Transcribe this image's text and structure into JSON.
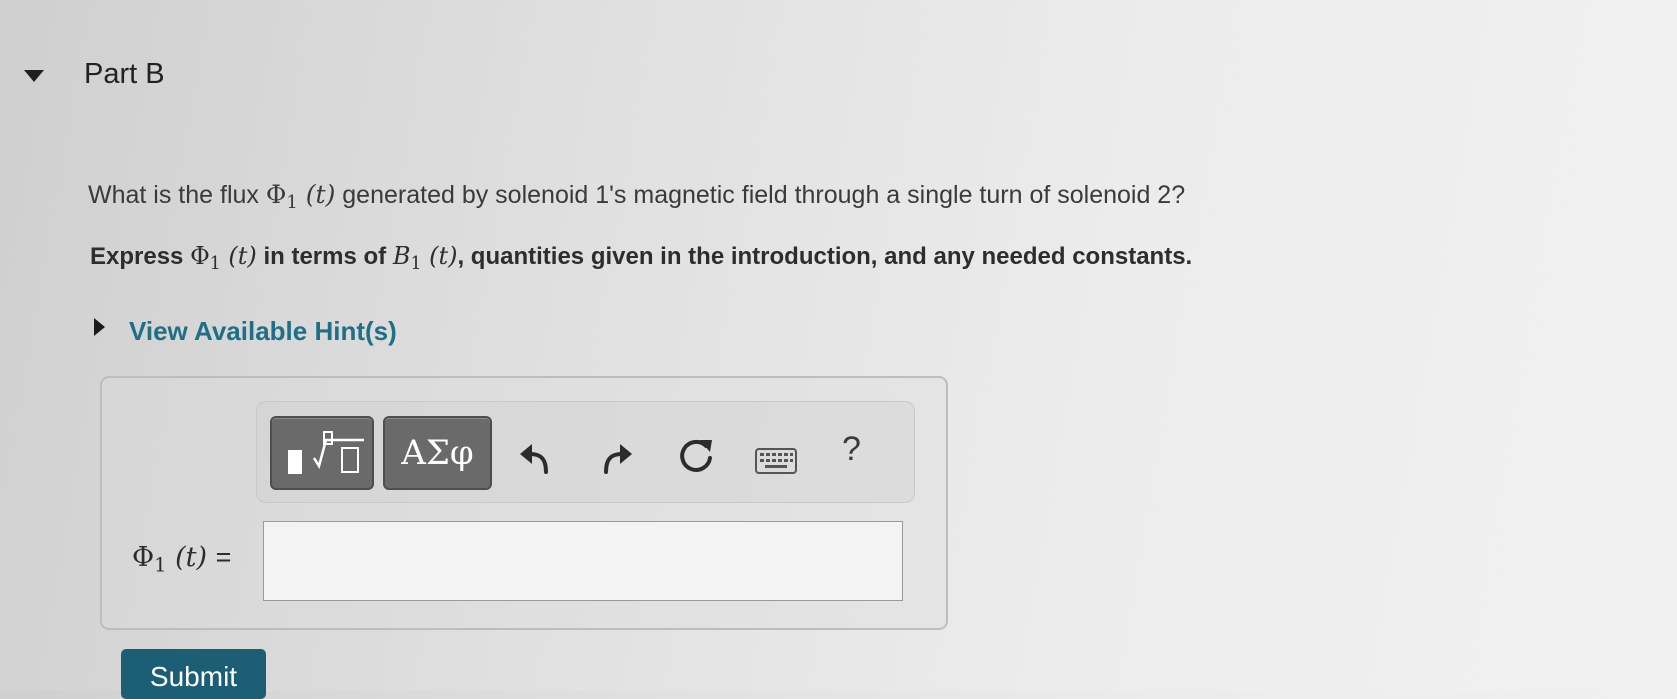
{
  "part": {
    "title": "Part B"
  },
  "question": {
    "text_1": "What is the flux",
    "phi": "Φ",
    "sub_1": "1",
    "arg": "(t)",
    "text_2": "generated by solenoid 1's magnetic field through a single turn of solenoid 2?"
  },
  "instruction": {
    "text_1": "Express",
    "phi": "Φ",
    "sub_1": "1",
    "arg": "(t)",
    "text_2": "in terms of",
    "b": "B",
    "sub_b": "1",
    "arg_b": "(t)",
    "text_3": ", quantities given in the introduction, and any needed constants."
  },
  "hints": {
    "label": "View Available Hint(s)"
  },
  "toolbar": {
    "symbols_label": "ΑΣφ",
    "help_label": "?",
    "icons": [
      "templates-icon",
      "undo-icon",
      "redo-icon",
      "reset-icon",
      "keyboard-icon",
      "help-icon"
    ]
  },
  "answer": {
    "phi": "Φ",
    "sub": "1",
    "arg": "(t)",
    "equals": "=",
    "value": ""
  },
  "submit": {
    "label": "Submit"
  },
  "colors": {
    "link": "#1f6f87",
    "submit_bg": "#1c5f75",
    "toolbar_button": "#6a6a6a"
  }
}
